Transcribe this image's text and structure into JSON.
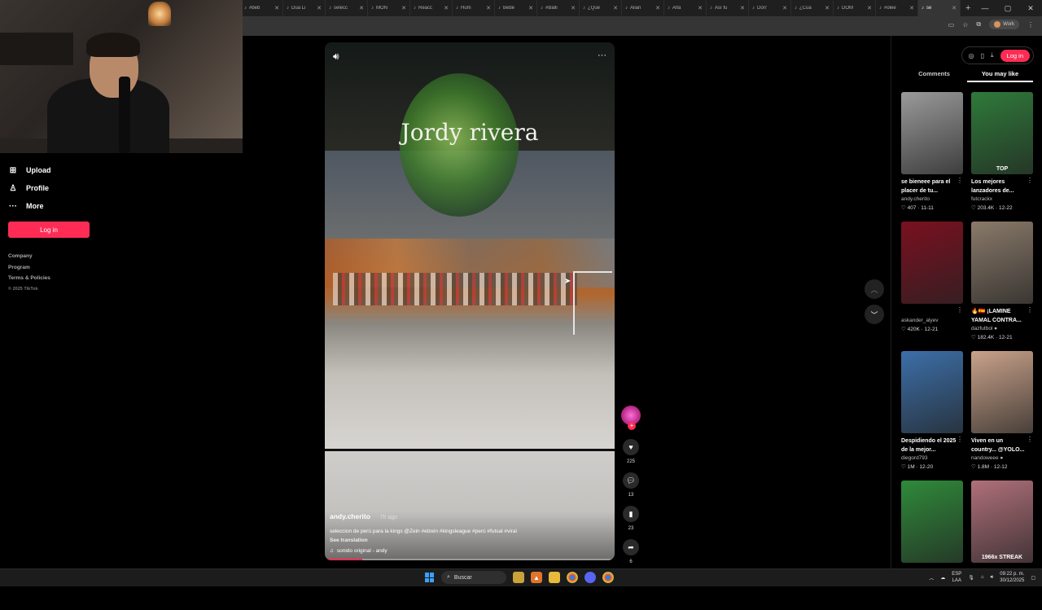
{
  "browser": {
    "tabs": [
      {
        "label": "#beb"
      },
      {
        "label": "Dua Li"
      },
      {
        "label": "selecc"
      },
      {
        "label": "MON"
      },
      {
        "label": "Reacc"
      },
      {
        "label": "Hum"
      },
      {
        "label": "Bebé"
      },
      {
        "label": "#Balli"
      },
      {
        "label": "¿Qué"
      },
      {
        "label": "Alian"
      },
      {
        "label": "Alfa"
      },
      {
        "label": "Así fu"
      },
      {
        "label": "Don'"
      },
      {
        "label": "¿Cuá"
      },
      {
        "label": "DOM"
      },
      {
        "label": "#olee"
      },
      {
        "label": "se"
      }
    ],
    "active_tab_index": 16,
    "new_tab_icon": "+",
    "profile_chip_label": "Work"
  },
  "sidebar": {
    "items": [
      {
        "label": "Upload",
        "icon": "upload-icon",
        "glyph": "⊞"
      },
      {
        "label": "Profile",
        "icon": "profile-icon",
        "glyph": "♙"
      },
      {
        "label": "More",
        "icon": "more-icon",
        "glyph": "···"
      }
    ],
    "login_label": "Log in",
    "footer_links": [
      "Company",
      "Program",
      "Terms & Policies"
    ],
    "copyright": "© 2025 TikTok"
  },
  "video": {
    "overlay_title": "Jordy rivera",
    "author": "andy.cherito",
    "time_ago": "· 7h ago",
    "description": "seleccion de perú para la kings @Zein #elzein #kingsleague #perú #futsal #viral",
    "see_translation": "See translation",
    "sound": "sonido original - andy",
    "progress": 0.13,
    "volume_icon": "volume-icon",
    "more_icon": "more-dots-icon"
  },
  "actions": {
    "likes": "225",
    "comments": "13",
    "saves": "23",
    "shares": "6"
  },
  "right_panel": {
    "login_label": "Log in",
    "tabs": [
      "Comments",
      "You may like"
    ],
    "active_tab": 1,
    "cards": [
      {
        "title": "se bieneee para el placer de tu...",
        "user": "andy.cherito",
        "stats": "♡ 407 · 11-11",
        "overlay": "",
        "color": "#9a9a9a"
      },
      {
        "title": "Los mejores lanzadores de...",
        "user": "futcrackx",
        "stats": "♡ 203.4K · 12-22",
        "overlay": "TOP",
        "color": "#2f7a3a"
      },
      {
        "title": "",
        "user": "askander_alyev",
        "stats": "♡ 420K · 12-21",
        "overlay": "",
        "color": "#7a1020"
      },
      {
        "title": "🔥🇪🇸 ¡LAMINE YAMAL CONTRA...",
        "user": "dazfutbol ●",
        "stats": "♡ 182.4K · 12-21",
        "overlay": "",
        "color": "#8a7a6a"
      },
      {
        "title": "Despidiendo el 2025 de la mejor...",
        "user": "diegord793",
        "stats": "♡ 1M · 12-20",
        "overlay": "",
        "color": "#3c6fa8"
      },
      {
        "title": "Viven en un country... @YOLO...",
        "user": "nandoweee ●",
        "stats": "♡ 1.8M · 12-12",
        "overlay": "",
        "color": "#c9a28a"
      },
      {
        "title": "",
        "user": "",
        "stats": "",
        "overlay": "",
        "color": "#2f8a3a"
      },
      {
        "title": "",
        "user": "",
        "stats": "",
        "overlay": "1966x STREAK",
        "color": "#b0707a"
      }
    ]
  },
  "taskbar": {
    "search_label": "Buscar",
    "lang_line1": "ESP",
    "lang_line2": "LAA",
    "time": "09:22 p. m.",
    "date": "30/12/2025"
  }
}
